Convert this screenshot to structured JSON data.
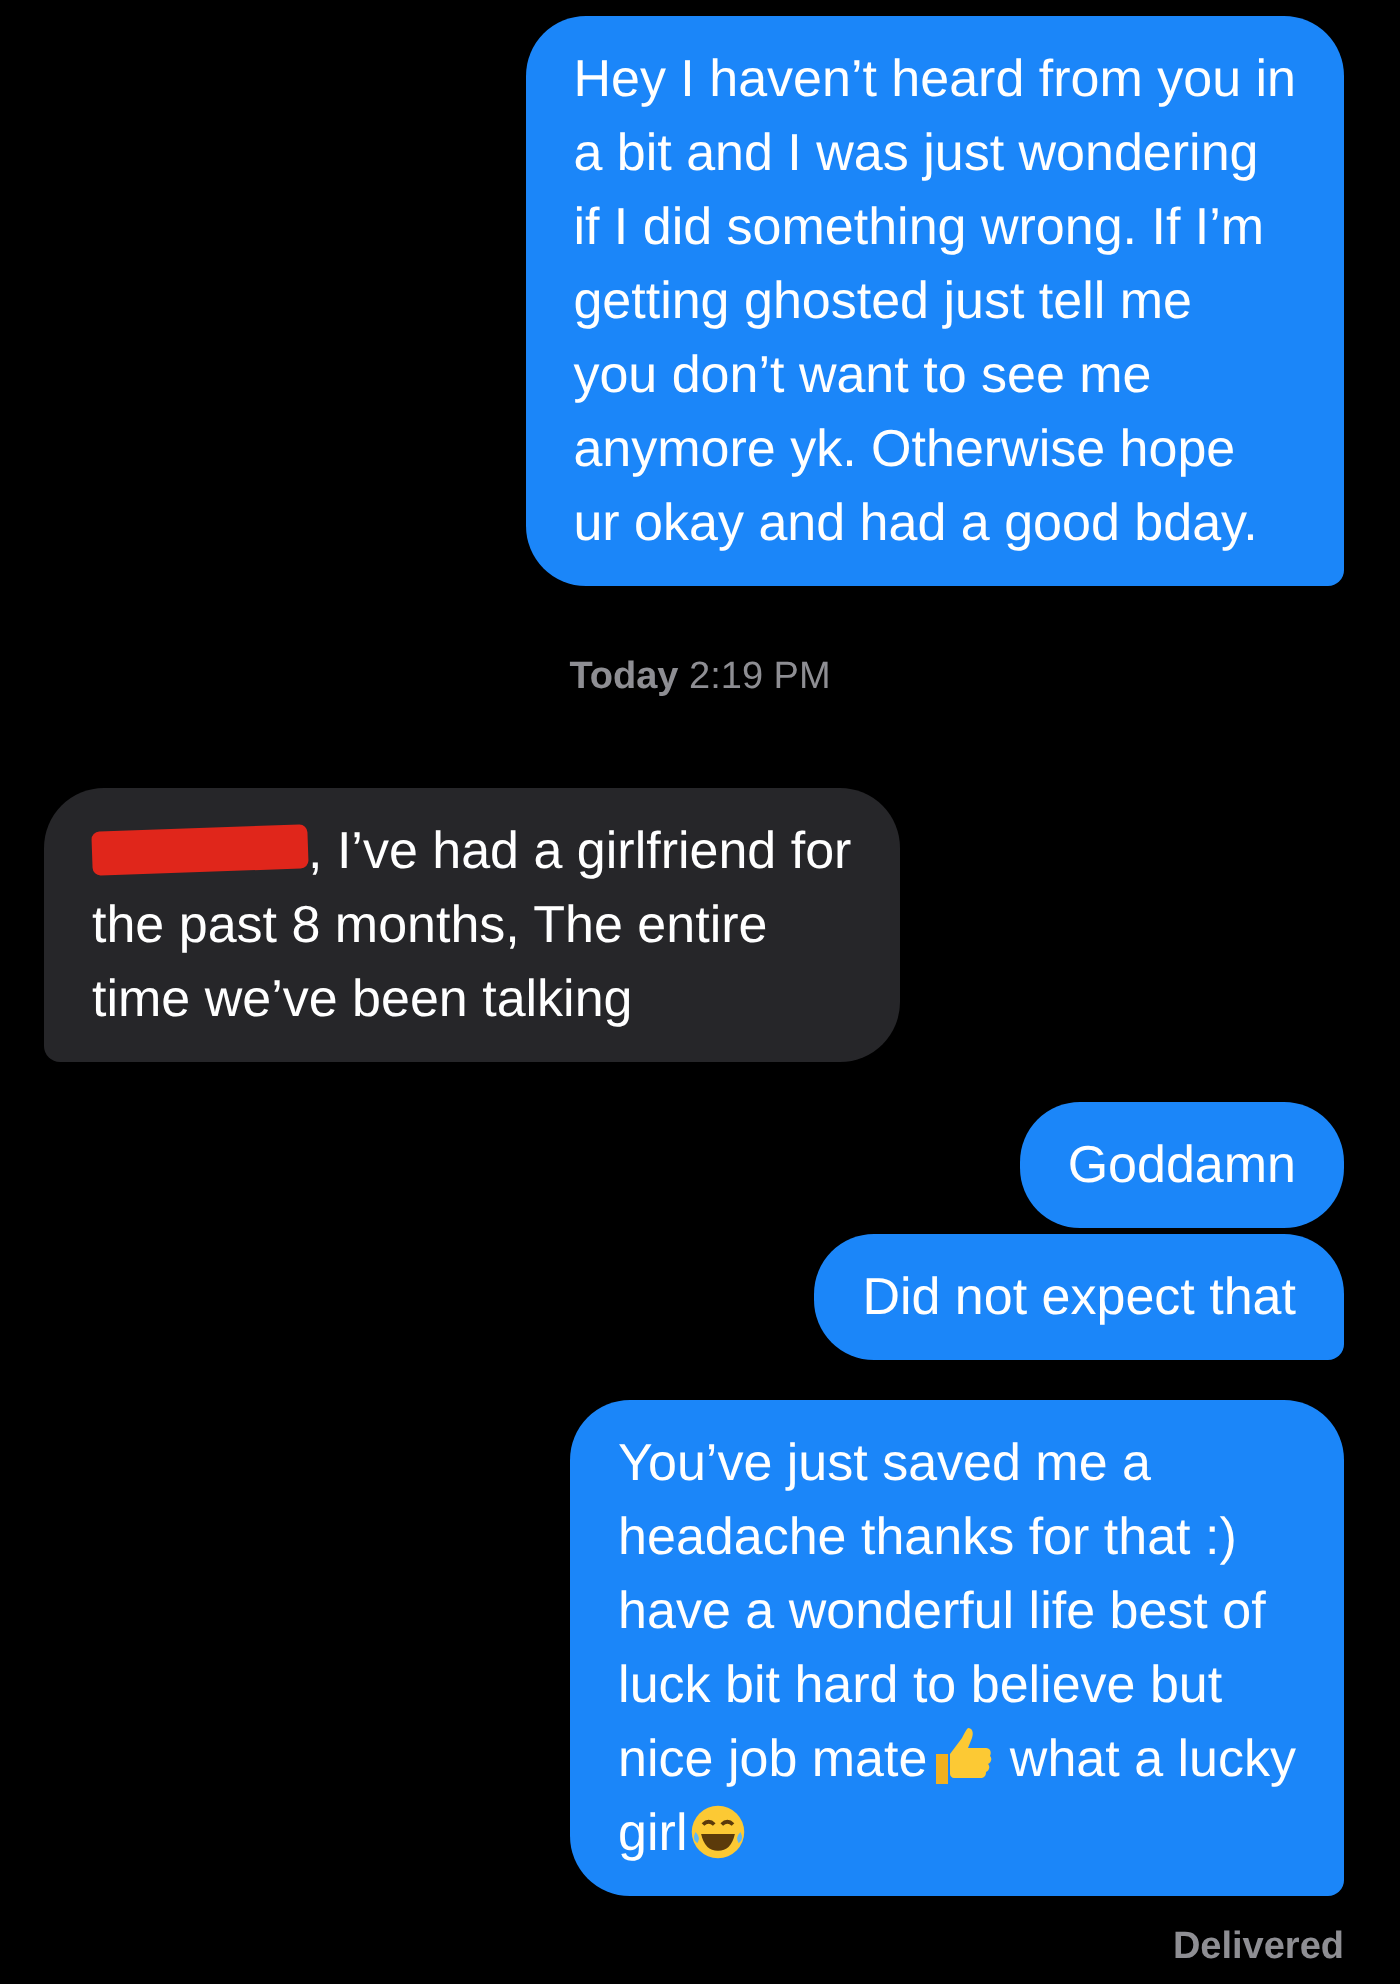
{
  "messages": [
    {
      "kind": "sent",
      "tail": true,
      "lines": [
        {
          "parts": [
            {
              "kind": "text",
              "text": "Hey I haven’t heard from you in"
            }
          ]
        },
        {
          "parts": [
            {
              "kind": "text",
              "text": "a bit and I was just wondering"
            }
          ]
        },
        {
          "parts": [
            {
              "kind": "text",
              "text": "if I did something wrong. If I’m"
            }
          ]
        },
        {
          "parts": [
            {
              "kind": "text",
              "text": "getting ghosted just tell me"
            }
          ]
        },
        {
          "parts": [
            {
              "kind": "text",
              "text": "you don’t want to see me"
            }
          ]
        },
        {
          "parts": [
            {
              "kind": "text",
              "text": "anymore yk. Otherwise hope"
            }
          ]
        },
        {
          "parts": [
            {
              "kind": "text",
              "text": "ur okay and had a good bday."
            }
          ]
        }
      ]
    },
    {
      "kind": "timestamp",
      "text": "**Today** 2:19 PM"
    },
    {
      "kind": "received",
      "tail": true,
      "lines": [
        {
          "parts": [
            {
              "kind": "redaction"
            },
            {
              "kind": "text",
              "text": ", I’ve had a girlfriend for"
            }
          ]
        },
        {
          "parts": [
            {
              "kind": "text",
              "text": "the past 8 months, The entire"
            }
          ]
        },
        {
          "parts": [
            {
              "kind": "text",
              "text": "time we’ve been talking"
            }
          ]
        }
      ]
    },
    {
      "kind": "sent",
      "tail": false,
      "lines": [
        {
          "parts": [
            {
              "kind": "text",
              "text": "Goddamn"
            }
          ]
        }
      ]
    },
    {
      "kind": "sent",
      "tail": true,
      "lines": [
        {
          "parts": [
            {
              "kind": "text",
              "text": "Did not expect that"
            }
          ]
        }
      ]
    },
    {
      "kind": "sent",
      "tail": true,
      "lines": [
        {
          "parts": [
            {
              "kind": "text",
              "text": "You’ve just saved me a"
            }
          ]
        },
        {
          "parts": [
            {
              "kind": "text",
              "text": "headache thanks for that :)"
            }
          ]
        },
        {
          "parts": [
            {
              "kind": "text",
              "text": "have a wonderful life best of"
            }
          ]
        },
        {
          "parts": [
            {
              "kind": "text",
              "text": "luck bit hard to believe but"
            }
          ]
        },
        {
          "parts": [
            {
              "kind": "text",
              "text": "nice job mate"
            },
            {
              "kind": "thumbs-up"
            },
            {
              "kind": "text",
              "text": " what a lucky"
            }
          ]
        },
        {
          "parts": [
            {
              "kind": "text",
              "text": "girl"
            },
            {
              "kind": "laughing"
            }
          ]
        }
      ]
    }
  ],
  "status": "Delivered"
}
